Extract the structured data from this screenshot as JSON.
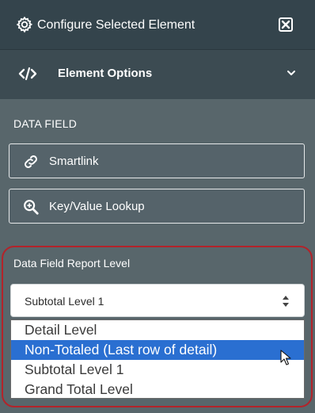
{
  "header": {
    "title": "Configure Selected Element",
    "icon": "gear-icon",
    "close_icon": "close-box-icon"
  },
  "section": {
    "title": "Element Options",
    "icon": "code-icon",
    "toggle_icon": "chevron-down-icon"
  },
  "data_field": {
    "title": "DATA FIELD",
    "buttons": [
      {
        "label": "Smartlink",
        "icon": "link-icon"
      },
      {
        "label": "Key/Value Lookup",
        "icon": "search-plus-icon"
      }
    ]
  },
  "report_level": {
    "title": "Data Field Report Level",
    "selected_value": "Subtotal Level 1",
    "options": [
      "Detail Level",
      "Non-Totaled (Last row of detail)",
      "Subtotal Level 1",
      "Grand Total Level"
    ],
    "highlighted_option": "Non-Totaled (Last row of detail)",
    "highlight_color": "#2a6fd1",
    "annotation_color": "#b3232a"
  }
}
